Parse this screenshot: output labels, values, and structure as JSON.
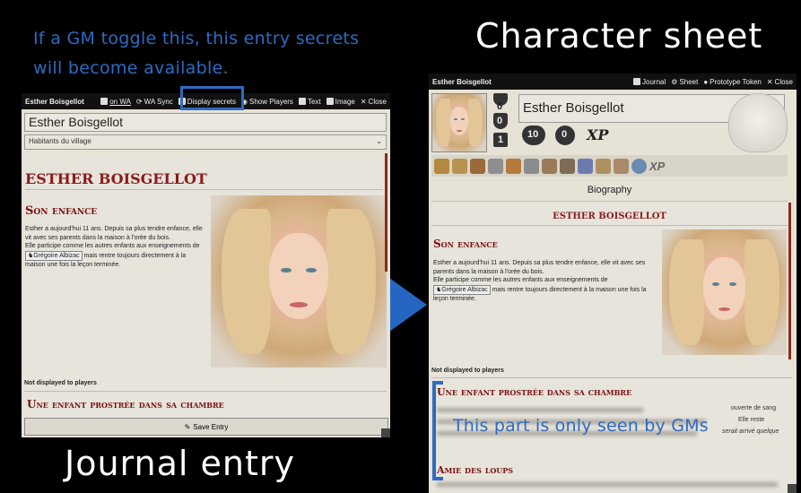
{
  "annotations": {
    "gm_toggle_line1": "If a GM toggle this, this entry secrets",
    "gm_toggle_line2": "will become available.",
    "character_sheet_label": "Character sheet",
    "journal_entry_label": "Journal entry",
    "gm_only_note": "This part is only seen by GMs",
    "accent_color": "#2d6bc2"
  },
  "journal": {
    "title": "Esther Boisgellot",
    "buttons": {
      "on_wa": "on WA",
      "wa_sync": "WA Sync",
      "display_secrets": "Display secrets",
      "show_players": "Show Players",
      "text": "Text",
      "image": "Image",
      "close": "Close"
    },
    "name_value": "Esther Boisgellot",
    "category_select": "Habitants du village",
    "heading": "ESTHER BOISGELLOT",
    "section1": "Son enfance",
    "paragraph1": "Esther a aujourd'hui 11 ans. Depuis sa plus tendre enfance, elle vit avec ses parents dans la maison à l'orée du bois.",
    "paragraph2a": "Elle participe comme les autres enfants aux enseignements de",
    "linked_name": "Grégoire Albizac",
    "paragraph2b": "mais rentre toujours directement à la maison une fois la leçon terminée.",
    "not_displayed": "Not displayed to players",
    "section2": "Une enfant prostrée dans sa chambre",
    "save_entry": "Save Entry"
  },
  "sheet": {
    "title": "Esther Boisgellot",
    "buttons": {
      "journal": "Journal",
      "sheet": "Sheet",
      "prototype_token": "Prototype Token",
      "close": "Close"
    },
    "name_value": "Esther Boisgellot",
    "stats": {
      "trophy": "0",
      "shield": "0",
      "lock": "1",
      "hp": "10",
      "def": "0",
      "xp": "XP"
    },
    "tab_xp": "XP",
    "biography_tab": "Biography",
    "heading": "ESTHER BOISGELLOT",
    "section1": "Son enfance",
    "paragraph1": "Esther a aujourd'hui 11 ans. Depuis sa plus tendre enfance, elle vit avec ses parents dans la maison à l'orée du bois.",
    "paragraph2a": "Elle participe comme les autres enfants aux enseignements de",
    "linked_name": "Grégoire Albizac",
    "paragraph2b": "mais rentre toujours directement à la maison une fois la leçon terminée.",
    "not_displayed": "Not displayed to players",
    "section2": "Une enfant prostrée dans sa chambre",
    "hidden_line1_end": "ouverte de sang",
    "hidden_line2_end": "Elle reste",
    "hidden_line3_end": "serait arrivé quelque",
    "section3": "Amie des loups"
  }
}
